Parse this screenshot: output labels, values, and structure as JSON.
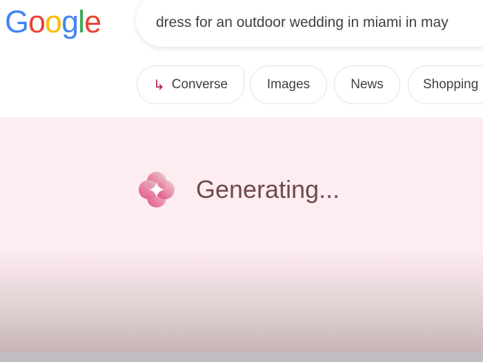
{
  "header": {
    "logo": "Google",
    "search_query": "dress for an outdoor wedding in miami in may",
    "chips": [
      {
        "label": "Converse",
        "icon": "arrow-turn-right-icon",
        "accent": "#b0185a"
      },
      {
        "label": "Images"
      },
      {
        "label": "News"
      },
      {
        "label": "Shopping"
      }
    ]
  },
  "main": {
    "status": "Generating...",
    "icon": "gemini-sparkle-icon"
  }
}
